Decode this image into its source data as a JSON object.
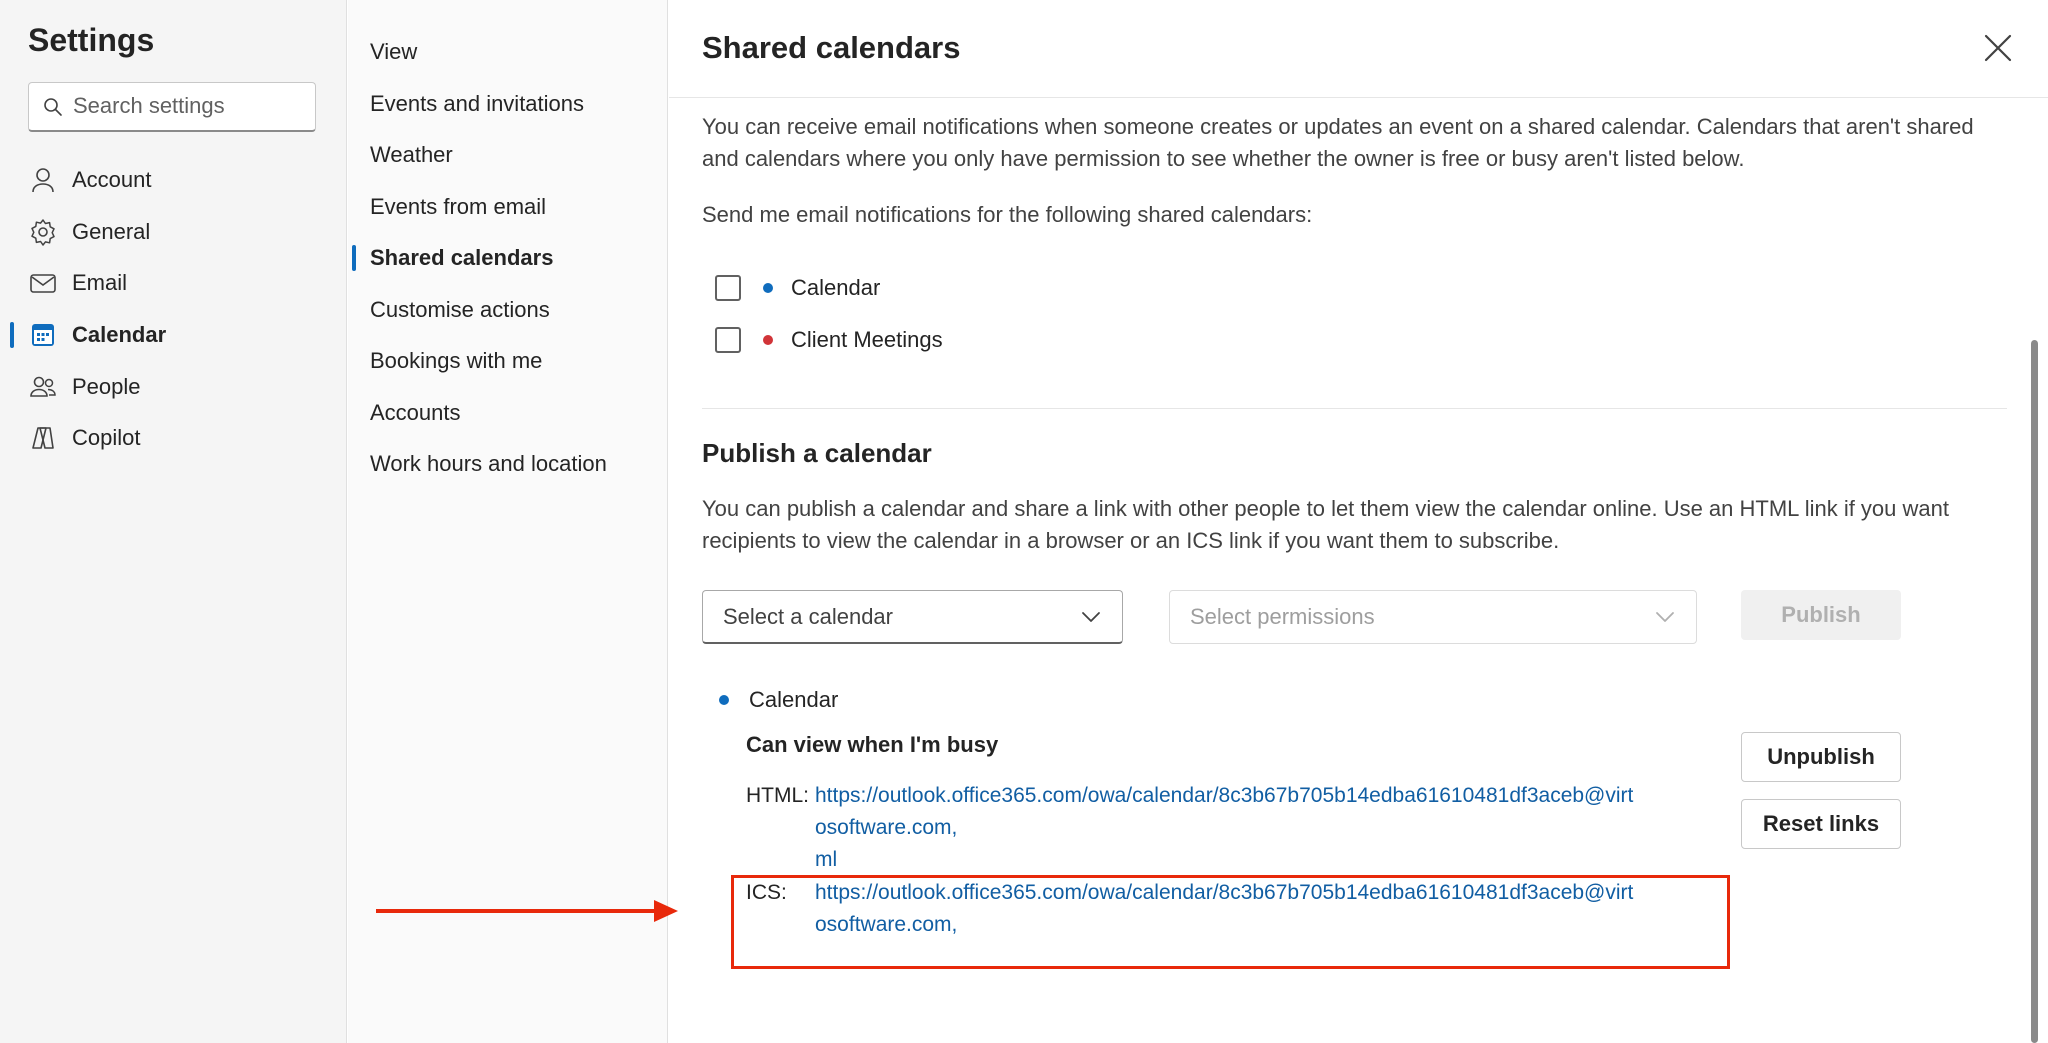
{
  "settings": {
    "title": "Settings",
    "search_placeholder": "Search settings"
  },
  "nav": [
    {
      "label": "Account",
      "icon": "person-icon"
    },
    {
      "label": "General",
      "icon": "gear-icon"
    },
    {
      "label": "Email",
      "icon": "mail-icon"
    },
    {
      "label": "Calendar",
      "icon": "calendar-icon",
      "active": true
    },
    {
      "label": "People",
      "icon": "people-icon"
    },
    {
      "label": "Copilot",
      "icon": "copilot-icon"
    }
  ],
  "subnav": [
    {
      "label": "View"
    },
    {
      "label": "Events and invitations"
    },
    {
      "label": "Weather"
    },
    {
      "label": "Events from email"
    },
    {
      "label": "Shared calendars",
      "active": true
    },
    {
      "label": "Customise actions"
    },
    {
      "label": "Bookings with me"
    },
    {
      "label": "Accounts"
    },
    {
      "label": "Work hours and location"
    }
  ],
  "content": {
    "title": "Shared calendars",
    "intro_line1": "You can receive email notifications when someone creates or updates an event on a shared calendar. Calendars that aren't shared",
    "intro_line2": "and calendars where you only have permission to see whether the owner is free or busy aren't listed below.",
    "notify_label": "Send me email notifications for the following shared calendars:",
    "calendars": [
      {
        "name": "Calendar",
        "color": "#0f6cbd",
        "checked": false
      },
      {
        "name": "Client Meetings",
        "color": "#d13438",
        "checked": false
      }
    ],
    "publish": {
      "title": "Publish a calendar",
      "desc_line1": "You can publish a calendar and share a link with other people to let them view the calendar online. Use an HTML link if you want",
      "desc_line2": "recipients to view the calendar in a browser or an ICS link if you want them to subscribe.",
      "select_calendar": "Select a calendar",
      "select_permissions": "Select permissions",
      "publish_label": "Publish"
    },
    "published": {
      "calendar_name": "Calendar",
      "calendar_color": "#0f6cbd",
      "permission": "Can view when I'm busy",
      "html_label": "HTML:",
      "html_line1": "https://outlook.office365.com/owa/calendar/8c3b67b705b14edba61610481df3aceb@virt",
      "html_line2": "osoftware.com,",
      "html_line3": "ml",
      "ics_label": "ICS:",
      "ics_line1": "https://outlook.office365.com/owa/calendar/8c3b67b705b14edba61610481df3aceb@virt",
      "ics_line2": "osoftware.com,",
      "unpublish_label": "Unpublish",
      "reset_label": "Reset links"
    }
  },
  "colors": {
    "accent": "#0f6cbd",
    "link": "#115ea3",
    "annotation": "#e8290b"
  }
}
